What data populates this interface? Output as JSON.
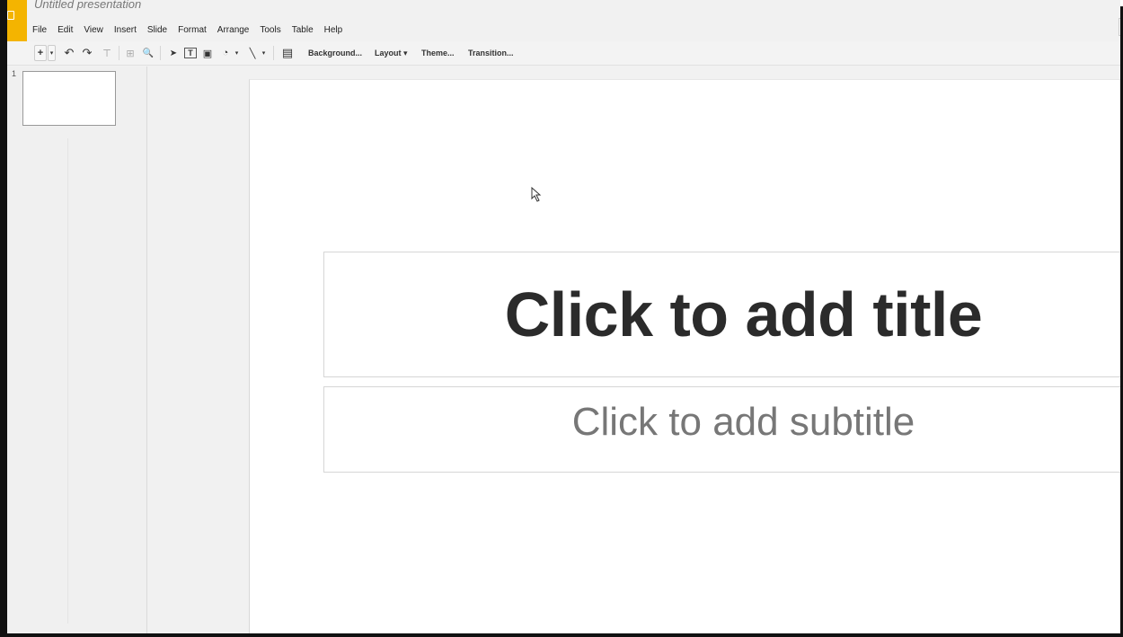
{
  "app": {
    "title": "Untitled presentation"
  },
  "menu": [
    {
      "label": "File"
    },
    {
      "label": "Edit"
    },
    {
      "label": "View"
    },
    {
      "label": "Insert"
    },
    {
      "label": "Slide"
    },
    {
      "label": "Format"
    },
    {
      "label": "Arrange"
    },
    {
      "label": "Tools"
    },
    {
      "label": "Table"
    },
    {
      "label": "Help"
    }
  ],
  "toolbar": {
    "new_slide": "+",
    "dropdown": "▾",
    "undo": "↶",
    "redo": "↷",
    "paint_format": "⊤",
    "zoom_fit": "⊞",
    "zoom": "🔍",
    "select": "➤",
    "text_box": "T",
    "image": "▣",
    "shape": "◔",
    "line": "╲",
    "comment": "▤",
    "background_label": "Background...",
    "layout_label": "Layout ▾",
    "theme_label": "Theme...",
    "transition_label": "Transition..."
  },
  "filmstrip": {
    "slides": [
      {
        "number": "1"
      }
    ]
  },
  "slide": {
    "title_placeholder": "Click to add title",
    "subtitle_placeholder": "Click to add subtitle"
  },
  "icons": {
    "logo": "slides-logo-icon",
    "cursor": "mouse-pointer-icon"
  },
  "colors": {
    "brand": "#f4b400",
    "title_text": "#2b2b2b",
    "subtitle_text": "#777777"
  }
}
